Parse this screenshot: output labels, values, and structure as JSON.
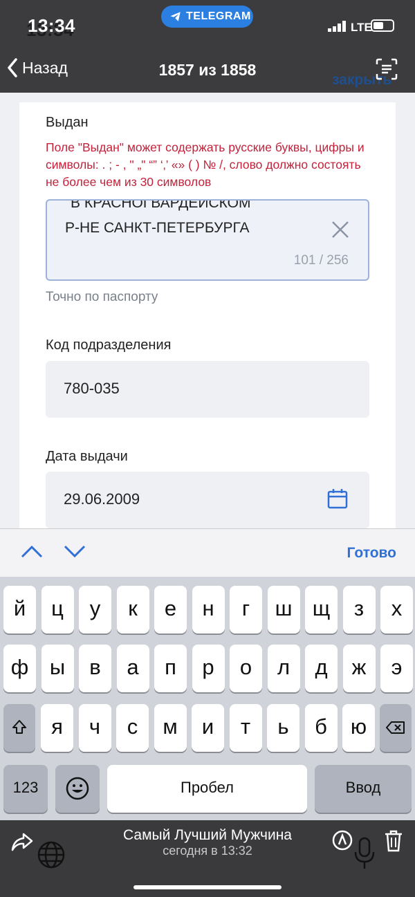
{
  "status_bar": {
    "time": "13:34",
    "telegram_pill": "TELEGRAM",
    "network": "LTE"
  },
  "nav": {
    "back_label": "Назад",
    "title": "1857 из 1858",
    "under_close": "закрыть"
  },
  "form": {
    "issued_label": "Выдан",
    "issued_error": "Поле \"Выдан\" может содержать русские буквы, цифры и символы: . ; - , \" „\" “” ‘‚’ «» ( ) № /, слово должно состоять не более чем из 30 символов",
    "issued_line1": "В КРАСНОГВАРДЕЙСКОМ",
    "issued_line2": "Р-НЕ САНКТ-ПЕТЕРБУРГА",
    "issued_counter": "101 / 256",
    "issued_hint": "Точно по паспорту",
    "division_label": "Код подразделения",
    "division_value": "780-035",
    "date_label": "Дата выдачи",
    "date_value": "29.06.2009"
  },
  "accessory": {
    "done_label": "Готово"
  },
  "keyboard": {
    "row1": [
      "й",
      "ц",
      "у",
      "к",
      "е",
      "н",
      "г",
      "ш",
      "щ",
      "з",
      "х"
    ],
    "row2": [
      "ф",
      "ы",
      "в",
      "а",
      "п",
      "р",
      "о",
      "л",
      "д",
      "ж",
      "э"
    ],
    "row3": [
      "я",
      "ч",
      "с",
      "м",
      "и",
      "т",
      "ь",
      "б",
      "ю"
    ],
    "numbers_key": "123",
    "space_key": "Пробел",
    "return_key": "Ввод"
  },
  "bottom_bar": {
    "sender": "Самый Лучший Мужчина",
    "time": "сегодня в 13:32"
  }
}
